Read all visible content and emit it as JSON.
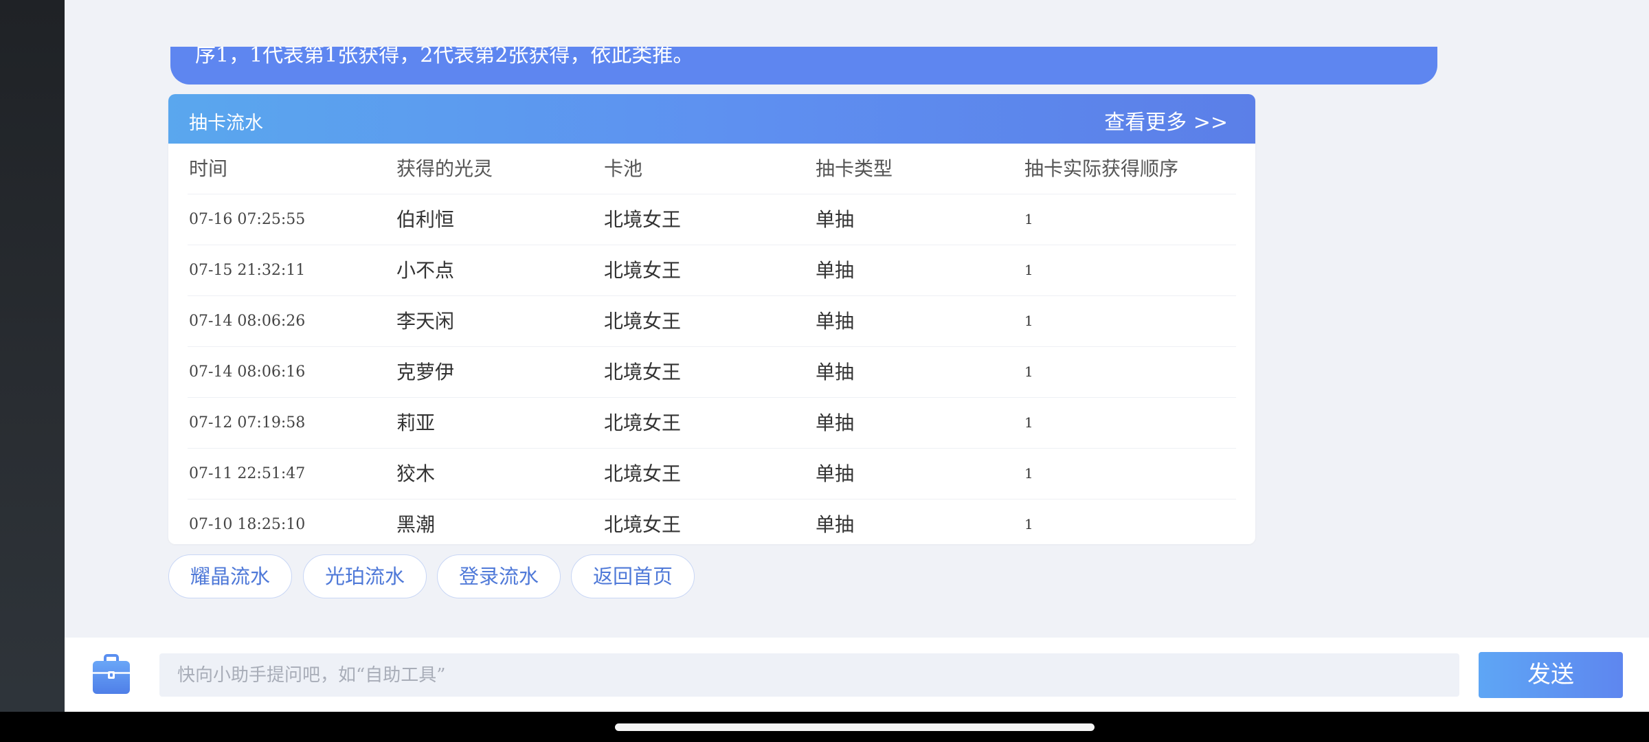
{
  "chat_message": {
    "text": "序1，1代表第1张获得，2代表第2张获得，依此类推。"
  },
  "draw_log": {
    "title": "抽卡流水",
    "more_label": "查看更多 >>",
    "columns": [
      "时间",
      "获得的光灵",
      "卡池",
      "抽卡类型",
      "抽卡实际获得顺序"
    ],
    "rows": [
      {
        "time": "07-16 07:25:55",
        "spirit": "伯利恒",
        "pool": "北境女王",
        "type": "单抽",
        "order": "1"
      },
      {
        "time": "07-15 21:32:11",
        "spirit": "小不点",
        "pool": "北境女王",
        "type": "单抽",
        "order": "1"
      },
      {
        "time": "07-14 08:06:26",
        "spirit": "李天闲",
        "pool": "北境女王",
        "type": "单抽",
        "order": "1"
      },
      {
        "time": "07-14 08:06:16",
        "spirit": "克萝伊",
        "pool": "北境女王",
        "type": "单抽",
        "order": "1"
      },
      {
        "time": "07-12 07:19:58",
        "spirit": "莉亚",
        "pool": "北境女王",
        "type": "单抽",
        "order": "1"
      },
      {
        "time": "07-11 22:51:47",
        "spirit": "狡木",
        "pool": "北境女王",
        "type": "单抽",
        "order": "1"
      },
      {
        "time": "07-10 18:25:10",
        "spirit": "黑潮",
        "pool": "北境女王",
        "type": "单抽",
        "order": "1"
      }
    ]
  },
  "quick_actions": [
    "耀晶流水",
    "光珀流水",
    "登录流水",
    "返回首页"
  ],
  "composer": {
    "placeholder": "快向小助手提问吧，如“自助工具”",
    "send_label": "发送",
    "toolbox_icon": "toolbox-icon"
  },
  "colors": {
    "accent": "#5e86f0",
    "header_gradient_start": "#5aa7ee",
    "pill_text": "#4f79d8"
  }
}
